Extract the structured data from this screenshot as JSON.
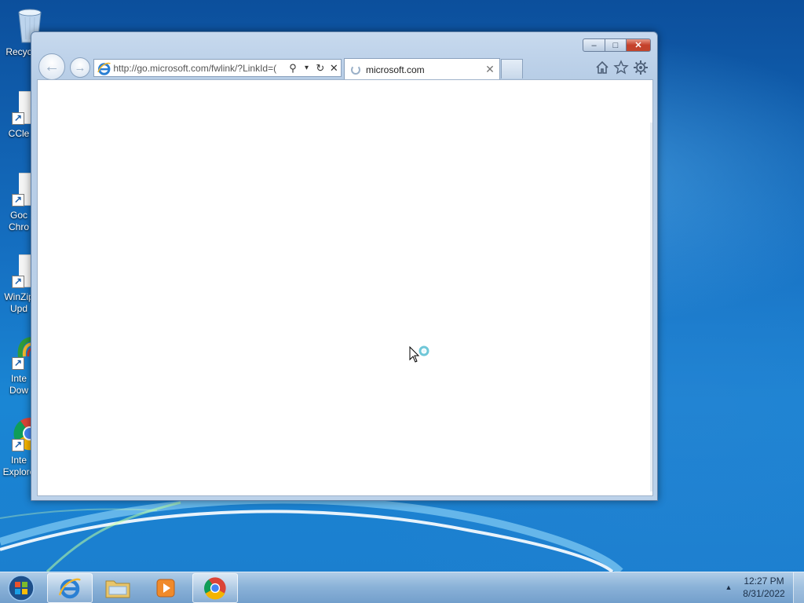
{
  "desktop": {
    "icons": [
      {
        "name": "recycle-bin",
        "label": "Recyc"
      },
      {
        "name": "ccleaner",
        "label": "CCle"
      },
      {
        "name": "google-chrome",
        "label_line1": "Goc",
        "label_line2": "Chro"
      },
      {
        "name": "winzip-update",
        "label_line1": "WinZip",
        "label_line2": "Upd"
      },
      {
        "name": "internet-download",
        "label_line1": "Inte",
        "label_line2": "Dow"
      },
      {
        "name": "internet-explorer",
        "label_line1": "Inte",
        "label_line2": "Explore"
      }
    ]
  },
  "browser": {
    "address_url": "http://go.microsoft.com/fwlink/?LinkId=(",
    "tab_title": "microsoft.com",
    "tab_loading": true,
    "caption": {
      "minimize": "–",
      "maximize": "□",
      "close": "✕"
    },
    "nav": {
      "back": "←",
      "forward": "→"
    },
    "address_buttons": {
      "search": "⚲",
      "dropdown": "▾",
      "refresh": "↻",
      "stop": "✕"
    },
    "tab_close": "✕"
  },
  "taskbar": {
    "items": [
      "start",
      "internet-explorer",
      "windows-explorer",
      "media-player",
      "google-chrome"
    ],
    "tray_arrow": "▲",
    "clock_time": "12:27 PM",
    "clock_date": "8/31/2022"
  },
  "colors": {
    "wallpaper": "#1570c2",
    "window_frame": "#bcd2ea",
    "close_button": "#c4402b"
  }
}
